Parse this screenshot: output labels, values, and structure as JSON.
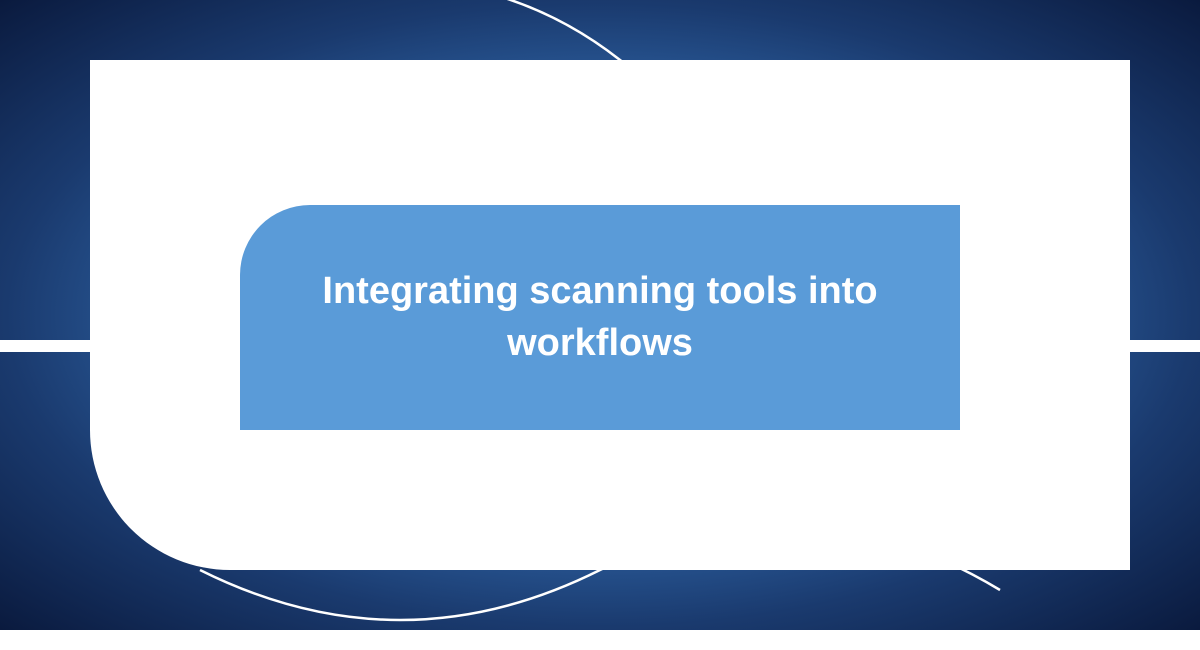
{
  "title": "Integrating scanning tools into workflows",
  "colors": {
    "accent": "#5a9bd8",
    "background_dark": "#0a1a3e",
    "background_mid": "#3a7bc4",
    "frame": "#ffffff"
  }
}
